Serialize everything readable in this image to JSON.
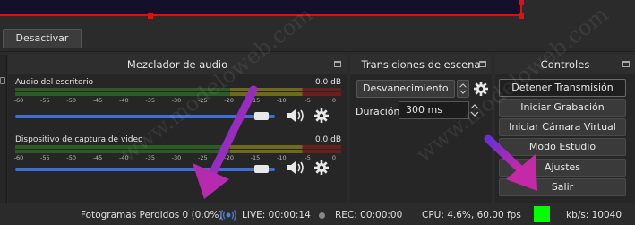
{
  "colors": {
    "accent_red": "#e01010",
    "slider_blue": "#3f6fd6",
    "arrow_purple": "#9b2bbf",
    "status_green": "#00ff00"
  },
  "toolbar": {
    "deactivate_label": "Desactivar"
  },
  "mixer": {
    "title": "Mezclador de audio",
    "ticks": [
      "-60",
      "-55",
      "-50",
      "-45",
      "-40",
      "-35",
      "-30",
      "-25",
      "-20",
      "-15",
      "-10",
      "-5",
      "0"
    ],
    "channels": [
      {
        "name": "Audio del escritorio",
        "db": "0.0 dB",
        "volume_fraction": 0.97
      },
      {
        "name": "Dispositivo de captura de video",
        "db": "0.0 dB",
        "volume_fraction": 0.97
      }
    ]
  },
  "transitions": {
    "title": "Transiciones de escena",
    "selected": "Desvanecimiento",
    "duration_label": "Duración",
    "duration_value": "300 ms"
  },
  "controls": {
    "title": "Controles",
    "buttons": [
      "Detener Transmisión",
      "Iniciar Grabación",
      "Iniciar Cámara Virtual",
      "Modo Estudio",
      "Ajustes",
      "Salir"
    ]
  },
  "status": {
    "dropped_frames": "Fotogramas Perdidos 0 (0.0%)",
    "live": "LIVE: 00:00:14",
    "rec": "REC: 00:00:00",
    "cpu": "CPU: 4.6%, 60.00 fps",
    "kbps": "kb/s: 10040"
  },
  "watermark": "www.modeloweb.com"
}
